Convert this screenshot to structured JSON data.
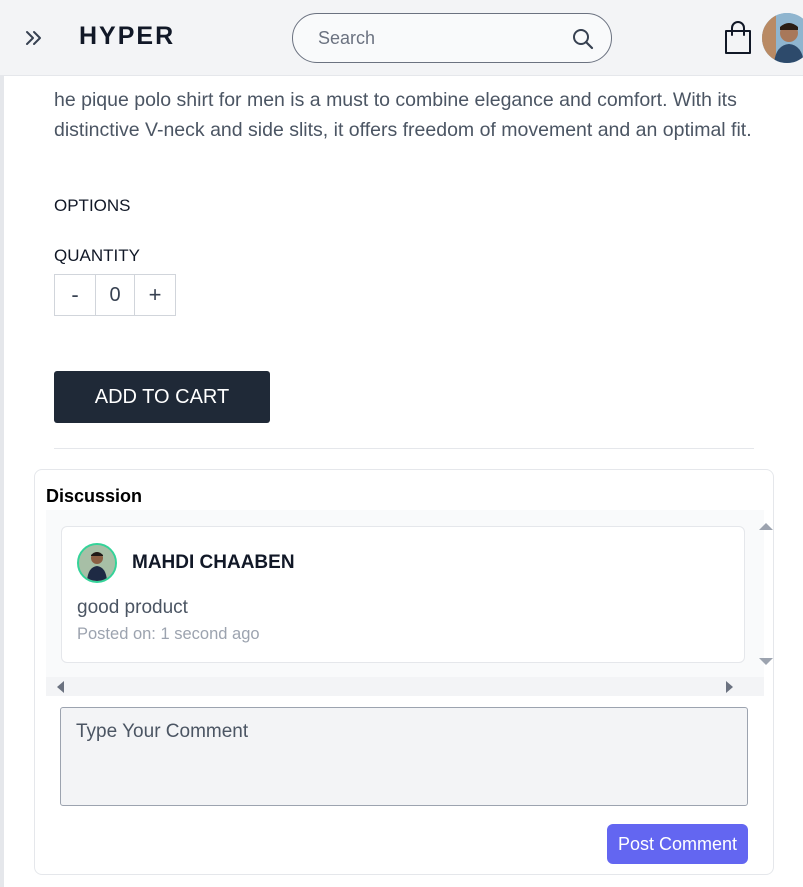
{
  "header": {
    "brand": "HYPER",
    "search_placeholder": "Search",
    "expand_icon": "double-chevron-right-icon",
    "search_icon": "search-icon",
    "cart_icon": "shopping-bag-icon"
  },
  "product": {
    "description": "he pique polo shirt for men is a must to combine elegance and comfort. With its distinctive V-neck and side slits, it offers freedom of movement and an optimal fit.",
    "options_label": "OPTIONS",
    "quantity_label": "QUANTITY",
    "quantity": {
      "decrement": "-",
      "value": "0",
      "increment": "+"
    },
    "add_to_cart": "ADD TO CART"
  },
  "discussion": {
    "title": "Discussion",
    "comments": [
      {
        "author": "MAHDI CHAABEN",
        "text": "good product",
        "posted": "Posted on: 1 second ago"
      }
    ],
    "comment_placeholder": "Type Your Comment",
    "post_button": "Post Comment"
  },
  "colors": {
    "header_bg": "#f3f4f6",
    "button_dark": "#1f2937",
    "accent": "#6366f1",
    "avatar_ring": "#34d399"
  }
}
